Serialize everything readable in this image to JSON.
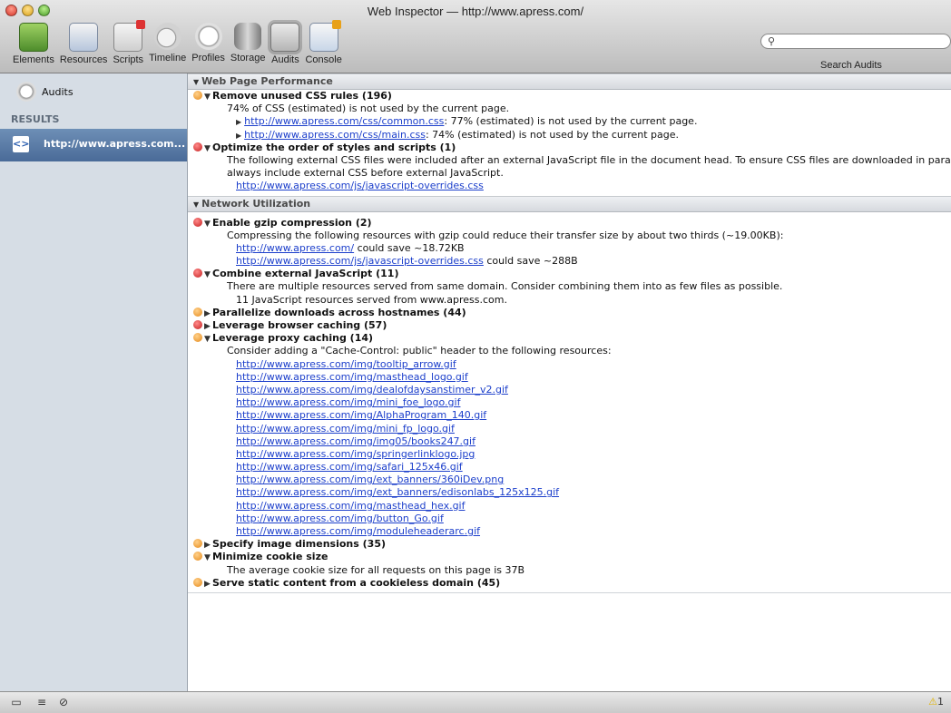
{
  "window": {
    "title": "Web Inspector — http://www.apress.com/"
  },
  "toolbar": [
    {
      "label": "Elements",
      "icon": "elements-icon"
    },
    {
      "label": "Resources",
      "icon": "resources-icon"
    },
    {
      "label": "Scripts",
      "icon": "scripts-icon"
    },
    {
      "label": "Timeline",
      "icon": "timeline-icon"
    },
    {
      "label": "Profiles",
      "icon": "profiles-icon"
    },
    {
      "label": "Storage",
      "icon": "storage-icon"
    },
    {
      "label": "Audits",
      "icon": "audits-icon",
      "active": true
    },
    {
      "label": "Console",
      "icon": "console-icon"
    }
  ],
  "search": {
    "label": "Search Audits",
    "value": ""
  },
  "sidebar": {
    "audits_label": "Audits",
    "results_header": "RESULTS",
    "selected_item": "http://www.apress.com..."
  },
  "sections": {
    "page_perf": "Web Page Performance",
    "network": "Network Utilization"
  },
  "rules": {
    "r1": {
      "title": "Remove unused CSS rules (196)",
      "severity": "orange",
      "desc": "74% of CSS (estimated) is not used by the current page.",
      "items": [
        {
          "url": "http://www.apress.com/css/common.css",
          "text": ": 77% (estimated) is not used by the current page."
        },
        {
          "url": "http://www.apress.com/css/main.css",
          "text": ": 74% (estimated) is not used by the current page."
        }
      ]
    },
    "r2": {
      "title": "Optimize the order of styles and scripts (1)",
      "severity": "red",
      "desc1": "The following external CSS files were included after an external JavaScript file in the document head. To ensure CSS files are downloaded in parallel,",
      "desc2": "always include external CSS before external JavaScript.",
      "url": "http://www.apress.com/js/javascript-overrides.css"
    },
    "r3": {
      "title": "Enable gzip compression (2)",
      "severity": "red",
      "desc": "Compressing the following resources with gzip could reduce their transfer size by about two thirds (~19.00KB):",
      "items": [
        {
          "url": "http://www.apress.com/",
          "text": " could save ~18.72KB"
        },
        {
          "url": "http://www.apress.com/js/javascript-overrides.css",
          "text": " could save ~288B"
        }
      ]
    },
    "r4": {
      "title": "Combine external JavaScript (11)",
      "severity": "red",
      "desc": "There are multiple resources served from same domain. Consider combining them into as few files as possible.",
      "sub": "11 JavaScript resources served from www.apress.com."
    },
    "r5": {
      "title": "Parallelize downloads across hostnames (44)",
      "severity": "orange"
    },
    "r6": {
      "title": "Leverage browser caching (57)",
      "severity": "red"
    },
    "r7": {
      "title": "Leverage proxy caching (14)",
      "severity": "orange",
      "desc": "Consider adding a \"Cache-Control: public\" header to the following resources:",
      "urls": [
        "http://www.apress.com/img/tooltip_arrow.gif",
        "http://www.apress.com/img/masthead_logo.gif",
        "http://www.apress.com/img/dealofdaysanstimer_v2.gif",
        "http://www.apress.com/img/mini_foe_logo.gif",
        "http://www.apress.com/img/AlphaProgram_140.gif",
        "http://www.apress.com/img/mini_fp_logo.gif",
        "http://www.apress.com/img/img05/books247.gif",
        "http://www.apress.com/img/springerlinklogo.jpg",
        "http://www.apress.com/img/safari_125x46.gif",
        "http://www.apress.com/img/ext_banners/360iDev.png",
        "http://www.apress.com/img/ext_banners/edisonlabs_125x125.gif",
        "http://www.apress.com/img/masthead_hex.gif",
        "http://www.apress.com/img/button_Go.gif",
        "http://www.apress.com/img/moduleheaderarc.gif"
      ]
    },
    "r8": {
      "title": "Specify image dimensions (35)",
      "severity": "orange"
    },
    "r9": {
      "title": "Minimize cookie size",
      "severity": "orange",
      "desc": "The average cookie size for all requests on this page is 37B"
    },
    "r10": {
      "title": "Serve static content from a cookieless domain (45)",
      "severity": "orange"
    }
  },
  "status": {
    "warnings": "1"
  },
  "colors": {
    "link": "#1c3fcb",
    "orange": "#e58a1b",
    "red": "#c41d1d",
    "selection": "#4a6b98"
  }
}
